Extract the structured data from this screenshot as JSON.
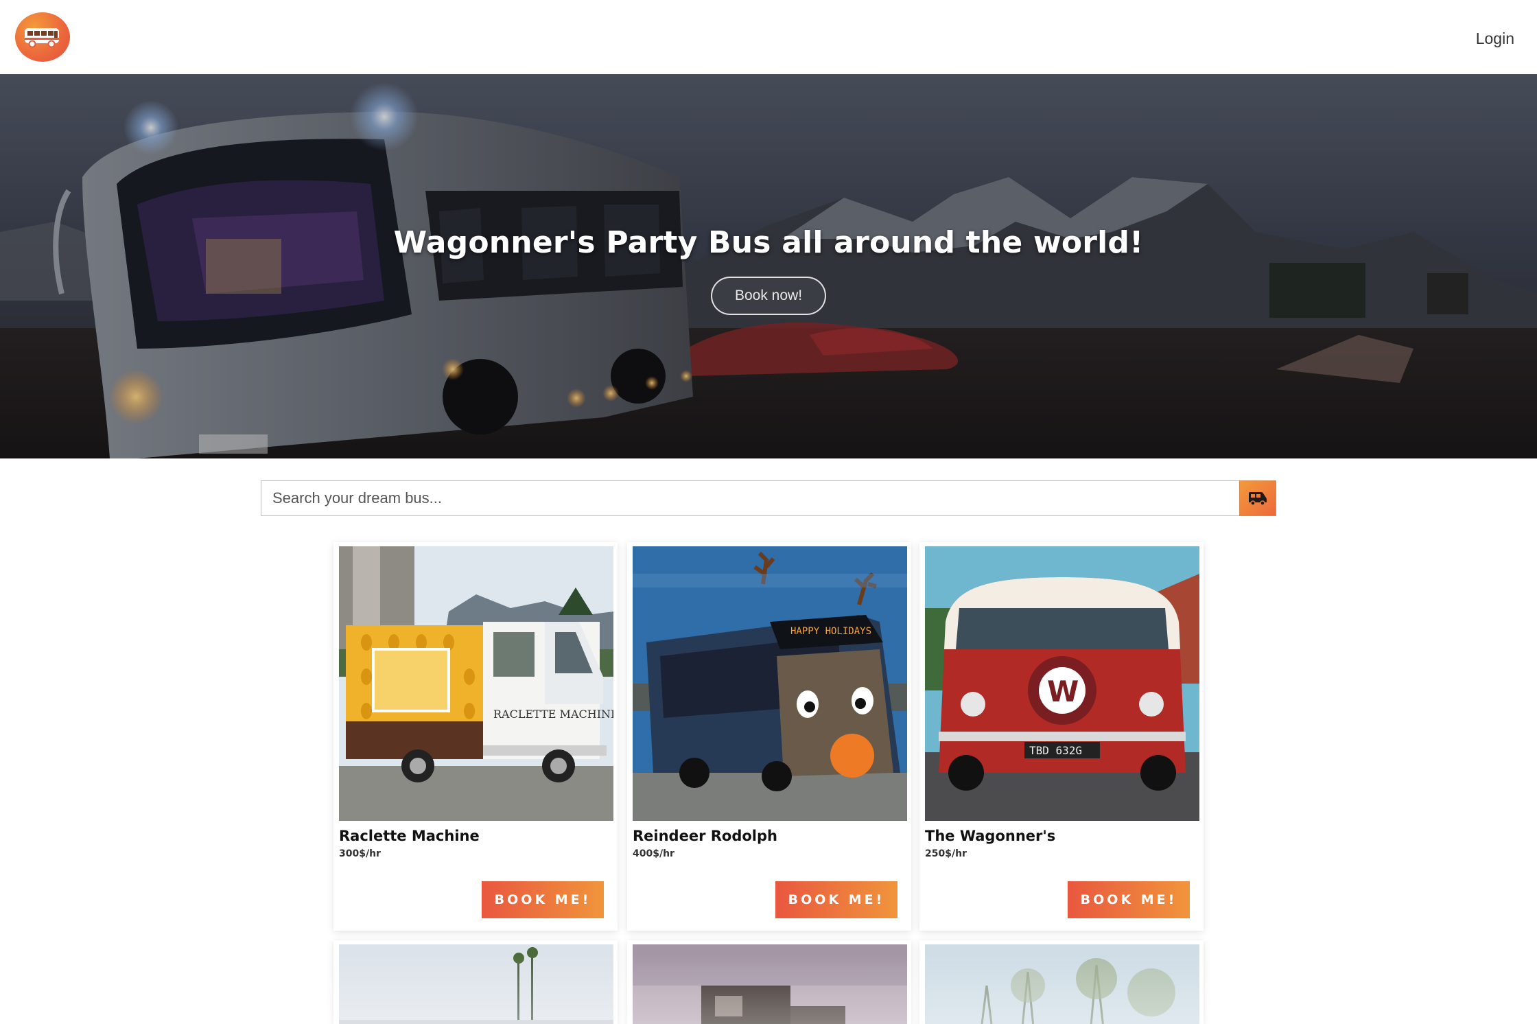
{
  "nav": {
    "login_label": "Login"
  },
  "hero": {
    "title": "Wagonner's Party Bus all around the world!",
    "cta_label": "Book now!"
  },
  "search": {
    "placeholder": "Search your dream bus...",
    "value": ""
  },
  "buses": [
    {
      "name": "Raclette Machine",
      "price": "300$/hr",
      "cta": "BOOK ME!"
    },
    {
      "name": "Reindeer Rodolph",
      "price": "400$/hr",
      "cta": "BOOK ME!"
    },
    {
      "name": "The Wagonner's",
      "price": "250$/hr",
      "cta": "BOOK ME!"
    }
  ],
  "colors": {
    "accent_start": "#e9573f",
    "accent_end": "#f0953c"
  },
  "icons": {
    "logo": "party-bus-logo",
    "search_button": "bus-icon"
  }
}
